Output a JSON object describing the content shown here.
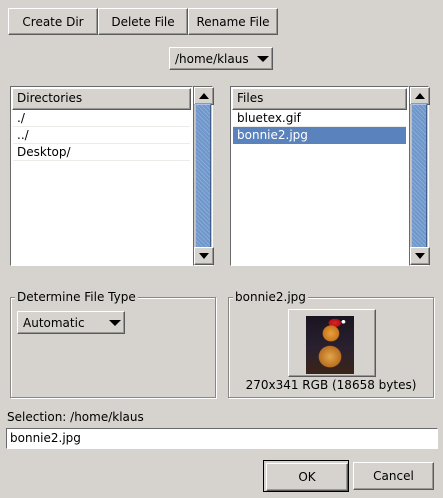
{
  "toolbar": {
    "create_dir_label": "Create Dir",
    "delete_file_label": "Delete File",
    "rename_file_label": "Rename File"
  },
  "path_combo": {
    "value": "/home/klaus",
    "icon": "chevron-down-icon"
  },
  "directories": {
    "header": "Directories",
    "items": [
      "./",
      "../",
      "Desktop/"
    ]
  },
  "files": {
    "header": "Files",
    "items": [
      "bluetex.gif",
      "bonnie2.jpg"
    ],
    "selected_index": 1
  },
  "file_type": {
    "group_label": "Determine File Type",
    "selected": "Automatic"
  },
  "preview": {
    "group_label": "bonnie2.jpg",
    "info": "270x341 RGB (18658 bytes)"
  },
  "selection": {
    "label": "Selection: /home/klaus",
    "value": "bonnie2.jpg"
  },
  "dialog": {
    "ok_label": "OK",
    "cancel_label": "Cancel"
  },
  "colors": {
    "background": "#d6d3ce",
    "selection": "#5a83be",
    "scroll_thumb": "#6f97cc"
  }
}
